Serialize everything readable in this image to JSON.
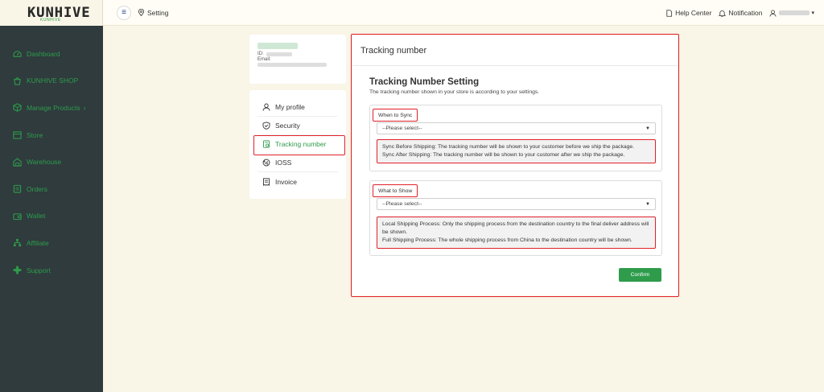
{
  "brand": {
    "logo": "KUNHIVE",
    "sub": "KUNHIVE"
  },
  "sidebar": {
    "items": [
      {
        "label": "Dashboard",
        "icon": "dashboard-icon"
      },
      {
        "label": "KUNHIVE SHOP",
        "icon": "shop-bag-icon"
      },
      {
        "label": "Manage Products",
        "icon": "products-cube-icon",
        "chevron": "›"
      },
      {
        "label": "Store",
        "icon": "store-icon"
      },
      {
        "label": "Warehouse",
        "icon": "warehouse-icon"
      },
      {
        "label": "Orders",
        "icon": "orders-icon"
      },
      {
        "label": "Wallet",
        "icon": "wallet-icon"
      },
      {
        "label": "Affiliate",
        "icon": "affiliate-icon"
      },
      {
        "label": "Support",
        "icon": "support-icon"
      }
    ],
    "accent": "#2e9c4b",
    "background": "#2f3b3d"
  },
  "header": {
    "menu_glyph": "≡",
    "breadcrumb": "Setting",
    "help_center": "Help Center",
    "notification": "Notification",
    "user_caret": "▾"
  },
  "profile": {
    "id_label": "ID:",
    "email_label": "Email:"
  },
  "settings_menu": {
    "items": [
      {
        "label": "My profile",
        "icon": "user-icon"
      },
      {
        "label": "Security",
        "icon": "shield-icon"
      },
      {
        "label": "Tracking number",
        "icon": "tracking-doc-icon",
        "active": true
      },
      {
        "label": "IOSS",
        "icon": "ioss-icon"
      },
      {
        "label": "Invoice",
        "icon": "invoice-icon"
      }
    ]
  },
  "main": {
    "title": "Tracking number",
    "heading": "Tracking Number Setting",
    "subtitle": "The tracking number shown in your store is according to your settings.",
    "when_to_sync": {
      "label": "When to Sync",
      "placeholder": "--Please select--",
      "note_lines": [
        "Sync Before Shipping: The tracking number will be shown to your customer before we ship the package.",
        "Sync After Shipping: The tracking number will be shown to your customer after we ship the package."
      ]
    },
    "what_to_show": {
      "label": "What to Show",
      "placeholder": "--Please select--",
      "note_lines": [
        "Local Shipping Process: Only the shipping process from the destination country to the final deliver address will be shown.",
        "Full Shipping Process: The whole shipping process from China to the destination country will be shown."
      ]
    },
    "confirm_label": "Confirm",
    "highlight_color": "#e0202a"
  }
}
